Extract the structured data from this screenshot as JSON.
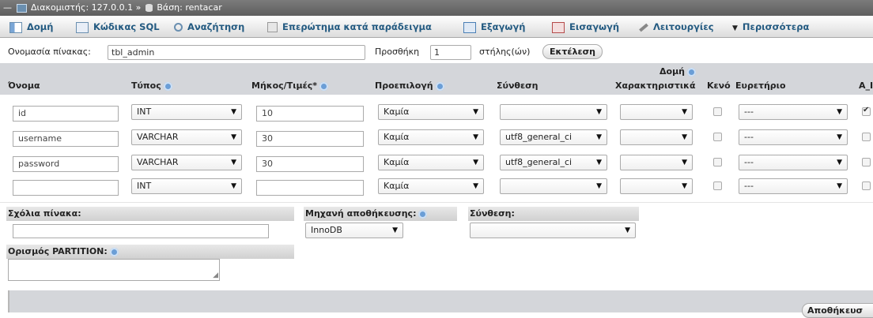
{
  "breadcrumb": {
    "server_label": "Διακομιστής:",
    "server": "127.0.0.1",
    "sep": "»",
    "db_label": "Βάση:",
    "db": "rentacar"
  },
  "tabs": [
    "Δομή",
    "Κώδικας SQL",
    "Αναζήτηση",
    "Επερώτημα κατά παράδειγμα",
    "Εξαγωγή",
    "Εισαγωγή",
    "Λειτουργίες",
    "Περισσότερα"
  ],
  "table_name": {
    "label": "Ονομασία πίνακας:",
    "value": "tbl_admin"
  },
  "add": {
    "label": "Προσθήκη",
    "value": "1",
    "suffix": "στήλης(ών)",
    "button": "Εκτέλεση"
  },
  "columns": {
    "group": "Δομή",
    "name": "Όνομα",
    "type": "Τύπος",
    "length": "Μήκος/Τιμές*",
    "default": "Προεπιλογή",
    "collation": "Σύνθεση",
    "attributes": "Χαρακτηριστικά",
    "null": "Κενό",
    "index": "Ευρετήριο",
    "ai": "A_I"
  },
  "rows": [
    {
      "name": "id",
      "type": "INT",
      "length": "10",
      "default": "Καμία",
      "collation": "",
      "attributes": "",
      "index": "---",
      "ai": true
    },
    {
      "name": "username",
      "type": "VARCHAR",
      "length": "30",
      "default": "Καμία",
      "collation": "utf8_general_ci",
      "attributes": "",
      "index": "---",
      "ai": false
    },
    {
      "name": "password",
      "type": "VARCHAR",
      "length": "30",
      "default": "Καμία",
      "collation": "utf8_general_ci",
      "attributes": "",
      "index": "---",
      "ai": false
    },
    {
      "name": "",
      "type": "INT",
      "length": "",
      "default": "Καμία",
      "collation": "",
      "attributes": "",
      "index": "---",
      "ai": false
    }
  ],
  "options": {
    "comments_label": "Σχόλια πίνακα:",
    "engine_label": "Μηχανή αποθήκευσης:",
    "engine": "InnoDB",
    "collation_label": "Σύνθεση:",
    "partition_label": "Ορισμός PARTITION:"
  },
  "save_button": "Αποθήκευσ",
  "colors": {
    "tab_text": "#235a81",
    "header_bg": "#d4d6da",
    "breadcrumb_bg": "#6b6b6b"
  }
}
